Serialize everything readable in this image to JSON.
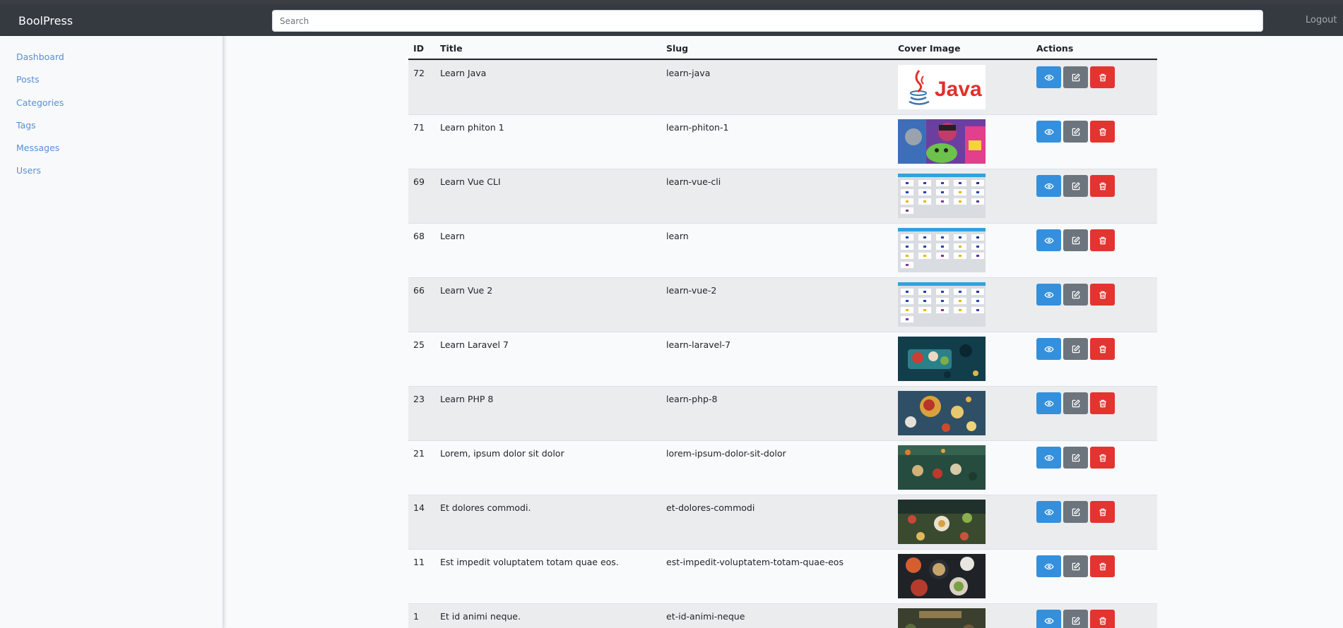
{
  "app": {
    "brand": "BoolPress",
    "logout": "Logout"
  },
  "search": {
    "placeholder": "Search",
    "value": ""
  },
  "sidebar": {
    "items": [
      {
        "label": "Dashboard"
      },
      {
        "label": "Posts"
      },
      {
        "label": "Categories"
      },
      {
        "label": "Tags"
      },
      {
        "label": "Messages"
      },
      {
        "label": "Users"
      }
    ]
  },
  "table": {
    "headers": {
      "id": "ID",
      "title": "Title",
      "slug": "Slug",
      "cover": "Cover Image",
      "actions": "Actions"
    },
    "rows": [
      {
        "id": "72",
        "title": "Learn Java",
        "slug": "learn-java",
        "cover": "java-logo",
        "cover_text": "Java"
      },
      {
        "id": "71",
        "title": "Learn phiton 1",
        "slug": "learn-phiton-1",
        "cover": "cartoon"
      },
      {
        "id": "69",
        "title": "Learn Vue CLI",
        "slug": "learn-vue-cli",
        "cover": "app-grid-screenshot"
      },
      {
        "id": "68",
        "title": "Learn",
        "slug": "learn",
        "cover": "app-grid-screenshot"
      },
      {
        "id": "66",
        "title": "Learn Vue 2",
        "slug": "learn-vue-2",
        "cover": "app-grid-screenshot"
      },
      {
        "id": "25",
        "title": "Learn Laravel 7",
        "slug": "learn-laravel-7",
        "cover": "food-photo-teal"
      },
      {
        "id": "23",
        "title": "Learn PHP 8",
        "slug": "learn-php-8",
        "cover": "food-photo-blue"
      },
      {
        "id": "21",
        "title": "Lorem, ipsum dolor sit dolor",
        "slug": "lorem-ipsum-dolor-sit-dolor",
        "cover": "food-photo-green"
      },
      {
        "id": "14",
        "title": "Et dolores commodi.",
        "slug": "et-dolores-commodi",
        "cover": "food-photo-market"
      },
      {
        "id": "11",
        "title": "Est impedit voluptatem totam quae eos.",
        "slug": "est-impedit-voluptatem-totam-quae-eos",
        "cover": "food-photo-plates"
      },
      {
        "id": "1",
        "title": "Et id animi neque.",
        "slug": "et-id-animi-neque",
        "cover": "food-photo-dark"
      }
    ]
  },
  "icons": {
    "view": "eye-icon",
    "edit": "edit-icon",
    "delete": "trash-icon"
  },
  "colors": {
    "navbar": "#343a40",
    "primary": "#3490dc",
    "secondary": "#6c757d",
    "danger": "#e3342f",
    "link": "#5b8ed7"
  }
}
